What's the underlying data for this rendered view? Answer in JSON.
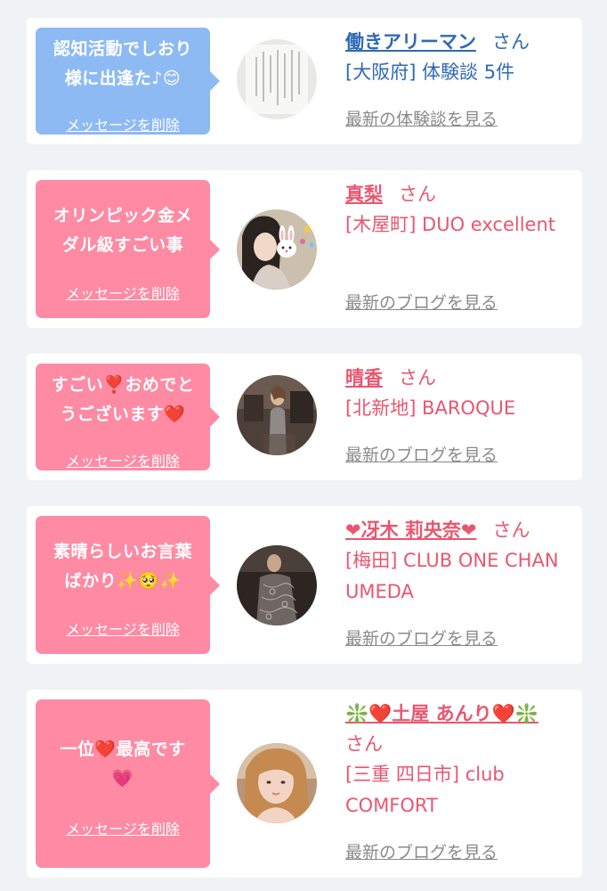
{
  "colors": {
    "bubble_pink": "#fe8aa3",
    "bubble_blue": "#8ebaf4",
    "name_blue": "#3069b4",
    "name_pink": "#e9566f",
    "link_gray": "#8a8a8a"
  },
  "delete_label": "メッセージを削除",
  "san_label": "さん",
  "cards": [
    {
      "message": "認知活動でしおり様に出逢た♪😊",
      "name": "働きアリーマン",
      "place": "[大阪府] 体験談 5件",
      "latest": "最新の体験談を見る",
      "avatar_icon": "handwritten-letter"
    },
    {
      "message": "オリンピック金メダル級すごい事",
      "name": "真梨",
      "place": "[木屋町] DUO excellent",
      "latest": "最新のブログを見る",
      "avatar_icon": "woman-with-bunny-sticker"
    },
    {
      "message": "すごい❣️おめでとうございます❤️",
      "name": "晴香",
      "place": "[北新地] BAROQUE",
      "latest": "最新のブログを見る",
      "avatar_icon": "woman-in-dress"
    },
    {
      "message": "素晴らしいお言葉ばかり✨🥺✨",
      "name": "❤冴木 莉央奈❤",
      "place": "[梅田] CLUB ONE CHAN UMEDA",
      "latest": "最新のブログを見る",
      "avatar_icon": "woman-in-lace-dress"
    },
    {
      "message": "一位❤️最高です💗",
      "name": "❇️❤️土屋 あんり❤️❇️",
      "place": "[三重 四日市] club COMFORT",
      "latest": "最新のブログを見る",
      "avatar_icon": "woman-portrait"
    }
  ]
}
